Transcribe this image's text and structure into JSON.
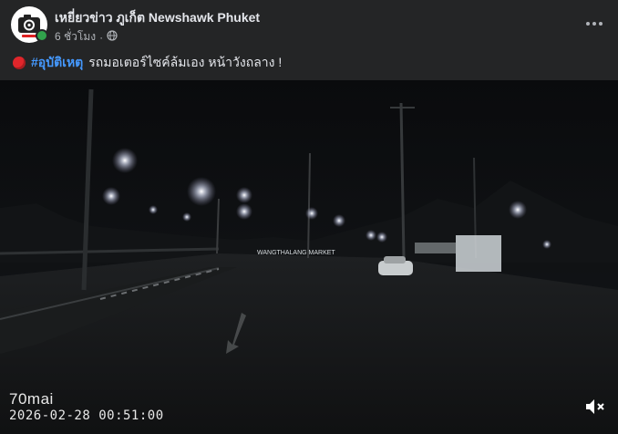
{
  "post": {
    "page_name": "เหยี่ยวข่าว ภูเก็ต Newshawk Phuket",
    "time": "6 ชั่วโมง",
    "separator": "·",
    "audience_icon": "globe-icon",
    "hashtag": "#อุบัติเหตุ",
    "caption_text": "รถมอเตอร์ไซค์ล้มเอง หน้าวังถลาง !",
    "caption_icon": "red-circle-icon"
  },
  "video": {
    "brand": "70mai",
    "timestamp": "2026-02-28  00:51:00",
    "sign_text": "WANGTHALANG MARKET",
    "mute_icon": "speaker-muted-icon"
  },
  "colors": {
    "background": "#242526",
    "text": "#e4e6eb",
    "secondary_text": "#b0b3b8",
    "hashtag": "#4599ff",
    "online": "#31a24c"
  }
}
